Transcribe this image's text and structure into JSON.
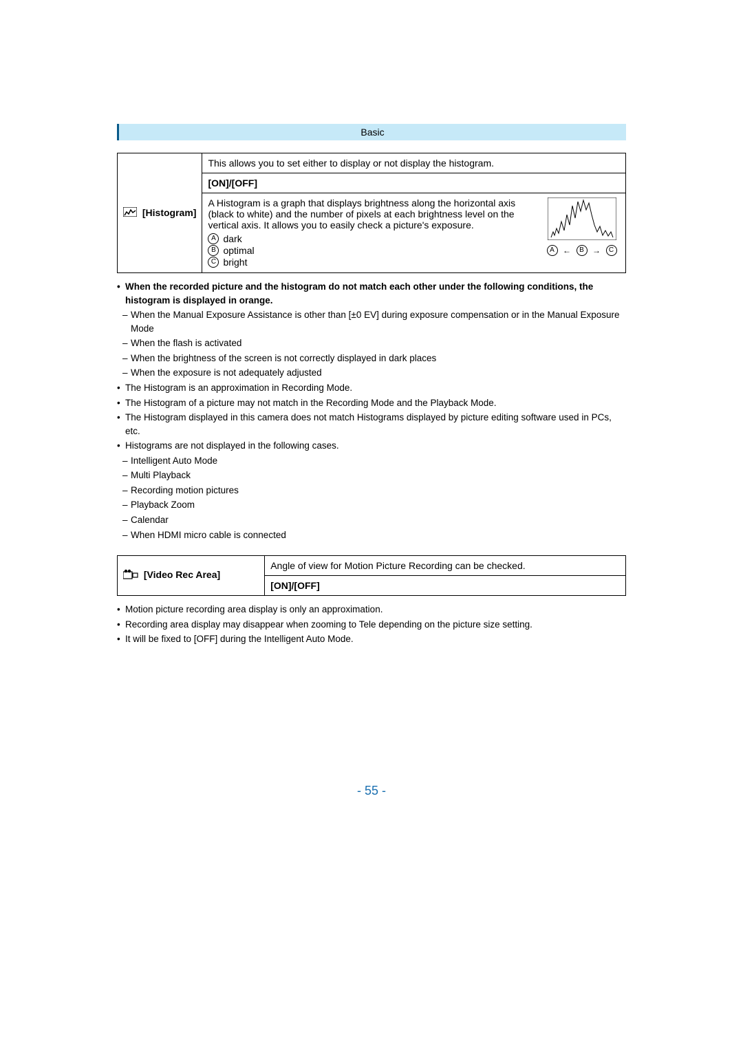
{
  "header": {
    "title": "Basic"
  },
  "histogram": {
    "label": "[Histogram]",
    "intro": "This allows you to set either to display or not display the histogram.",
    "onoff": "[ON]/[OFF]",
    "desc": "A Histogram is a graph that displays brightness along the horizontal axis (black to white) and the number of pixels at each brightness level on the vertical axis. It allows you to easily check a picture's exposure.",
    "legend": {
      "a": {
        "letter": "A",
        "text": "dark"
      },
      "b": {
        "letter": "B",
        "text": "optimal"
      },
      "c": {
        "letter": "C",
        "text": "bright"
      }
    }
  },
  "histogram_notes": {
    "n1": "When the recorded picture and the histogram do not match each other under the following conditions, the histogram is displayed in orange.",
    "n1a": "When the Manual Exposure Assistance is other than [±0 EV] during exposure compensation or in the Manual Exposure Mode",
    "n1b": "When the flash is activated",
    "n1c": "When the brightness of the screen is not correctly displayed in dark places",
    "n1d": "When the exposure is not adequately adjusted",
    "n2": "The Histogram is an approximation in Recording Mode.",
    "n3": "The Histogram of a picture may not match in the Recording Mode and the Playback Mode.",
    "n4": "The Histogram displayed in this camera does not match Histograms displayed by picture editing software used in PCs, etc.",
    "n5": "Histograms are not displayed in the following cases.",
    "n5a": "Intelligent Auto Mode",
    "n5b": "Multi Playback",
    "n5c": "Recording motion pictures",
    "n5d": "Playback Zoom",
    "n5e": "Calendar",
    "n5f": "When HDMI micro cable is connected"
  },
  "video_rec": {
    "label": "[Video Rec Area]",
    "desc": "Angle of view for Motion Picture Recording can be checked.",
    "onoff": "[ON]/[OFF]"
  },
  "video_rec_notes": {
    "n1": "Motion picture recording area display is only an approximation.",
    "n2": "Recording area display may disappear when zooming to Tele depending on the picture size setting.",
    "n3": "It will be fixed to [OFF] during the Intelligent Auto Mode."
  },
  "page_number": "- 55 -"
}
